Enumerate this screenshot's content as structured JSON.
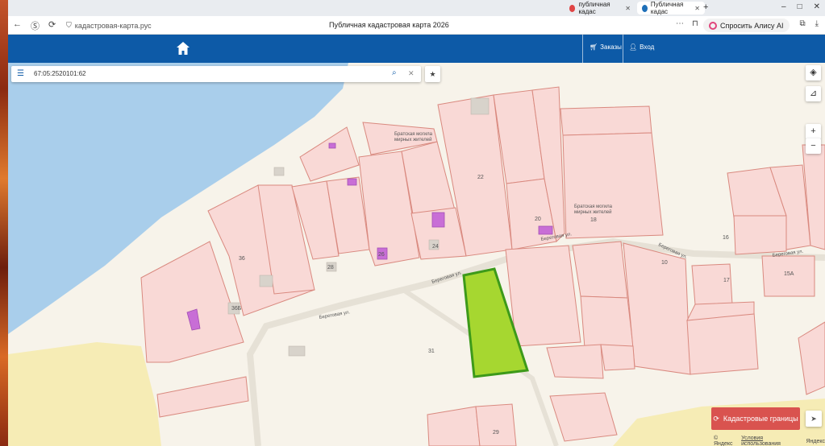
{
  "browser": {
    "tabs": [
      {
        "label": "публичная кадас",
        "icon_color": "#e04545"
      },
      {
        "label": "Публичная кадас",
        "icon_color": "#1e6fb8",
        "active": true
      }
    ],
    "new_tab": "+",
    "window_controls": [
      "–",
      "□",
      "✕"
    ],
    "url": "кадастровая-карта.рус",
    "page_title": "Публичная кадастровая карта 2026",
    "alice_label": "Спросить Алису AI"
  },
  "header": {
    "orders_label": "Заказы",
    "login_label": "Вход"
  },
  "search": {
    "value": "67:05:2520101:62"
  },
  "map_labels": {
    "memorial_1_line1": "Братская могила",
    "memorial_1_line2": "мирных жителей",
    "memorial_2_line1": "Братская могила",
    "memorial_2_line2": "мирных жителей",
    "street_beregovaya_1": "Береговая ул.",
    "street_beregovaya_2": "Береговая ул.",
    "street_beregovaya_3": "Береговая ул.",
    "street_beregovaya_4": "Береговая ул.",
    "parcel_22": "22",
    "parcel_20": "20",
    "parcel_18": "18",
    "parcel_16": "16",
    "parcel_10": "10",
    "parcel_17": "17",
    "parcel_15a": "15А",
    "parcel_24": "24",
    "parcel_26": "26",
    "parcel_28": "28",
    "parcel_36": "36",
    "parcel_36b": "36Б",
    "parcel_31": "31",
    "parcel_29": "29"
  },
  "controls": {
    "zoom_in": "+",
    "zoom_out": "−",
    "cadastral_borders_label": "Кадастровые границы"
  },
  "footer": {
    "yandex_brand": "© Яндекс",
    "terms": "Условия использования",
    "brand": "Яндекс"
  },
  "colors": {
    "header_blue": "#0d5aa7",
    "parcel_fill": "#f9d9d6",
    "parcel_stroke": "#d9897f",
    "water": "#a9ceeb",
    "selected_fill": "#a6d730",
    "selected_stroke": "#3d9a1a",
    "building": "#c86ed6",
    "sand": "#f6ecb5",
    "cad_button": "#d9534f"
  }
}
